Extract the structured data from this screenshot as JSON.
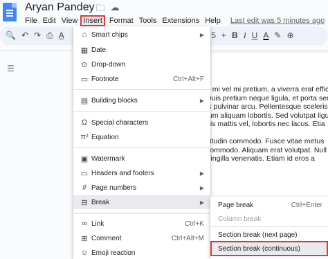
{
  "doc": {
    "title": "Aryan Pandey",
    "star_icon": "star-icon",
    "folder_icon": "folder-icon",
    "cloud_icon": "cloud-status-icon"
  },
  "menubar": {
    "items": [
      "File",
      "Edit",
      "View",
      "Insert",
      "Format",
      "Tools",
      "Extensions",
      "Help"
    ],
    "active": "Insert",
    "last_edit": "Last edit was 5 minutes ago"
  },
  "toolbar": {
    "font_size_partial": ".5",
    "bold": "B",
    "italic": "I",
    "underline": "U",
    "text_color": "A"
  },
  "insert_menu": {
    "items": [
      {
        "label": "Smart chips",
        "icon": "smart-chips-icon",
        "submenu": true
      },
      {
        "label": "Date",
        "icon": "calendar-icon"
      },
      {
        "label": "Drop-down",
        "icon": "dropdown-icon"
      },
      {
        "label": "Footnote",
        "icon": "footnote-icon",
        "shortcut": "Ctrl+Alt+F"
      },
      {
        "label": "Building blocks",
        "icon": "building-blocks-icon",
        "submenu": true
      },
      {
        "label": "Special characters",
        "icon": "omega-icon"
      },
      {
        "label": "Equation",
        "icon": "pi-icon"
      },
      {
        "label": "Watermark",
        "icon": "watermark-icon"
      },
      {
        "label": "Headers and footers",
        "icon": "headers-footers-icon",
        "submenu": true
      },
      {
        "label": "Page numbers",
        "icon": "hash-icon",
        "submenu": true
      },
      {
        "label": "Break",
        "icon": "break-icon",
        "submenu": true,
        "highlighted": true
      },
      {
        "label": "Link",
        "icon": "link-icon",
        "shortcut": "Ctrl+K"
      },
      {
        "label": "Comment",
        "icon": "comment-icon",
        "shortcut": "Ctrl+Alt+M"
      },
      {
        "label": "Emoji reaction",
        "icon": "emoji-icon"
      }
    ]
  },
  "break_submenu": {
    "items": [
      {
        "label": "Page break",
        "shortcut": "Ctrl+Enter"
      },
      {
        "label": "Column break",
        "disabled": true
      },
      {
        "label": "Section break (next page)"
      },
      {
        "label": "Section break (continuous)",
        "highlighted": true
      }
    ]
  },
  "page_text": {
    "para1": [
      "n mi vel mi pretium, a viverra erat efficit",
      "Duis pretium neque ligula, et porta sem",
      "is pulvinar arcu. Pellentesque sceleris",
      "tum aliquam lobortis. Sed volutpat ligu",
      "uis mattis vel, lobortis nec lacus. Etia"
    ],
    "para2": [
      "citudin commodo. Fusce vitae metus",
      "commodo. Aliquam erat volutpat. Null",
      "fringilla venenatis. Etiam id eros a"
    ]
  },
  "colors": {
    "highlight_box": "#e53935",
    "docs_blue": "#4285f4",
    "toolbar_bg": "#edf2fa"
  }
}
